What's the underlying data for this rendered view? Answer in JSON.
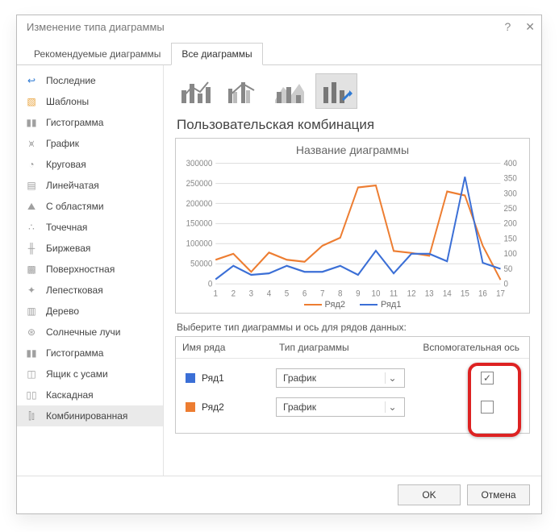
{
  "titlebar": {
    "title": "Изменение типа диаграммы"
  },
  "tabs": {
    "recommended": "Рекомендуемые диаграммы",
    "all": "Все диаграммы"
  },
  "sidebar": {
    "items": [
      "Последние",
      "Шаблоны",
      "Гистограмма",
      "График",
      "Круговая",
      "Линейчатая",
      "С областями",
      "Точечная",
      "Биржевая",
      "Поверхностная",
      "Лепестковая",
      "Дерево",
      "Солнечные лучи",
      "Гистограмма",
      "Ящик с усами",
      "Каскадная",
      "Комбинированная"
    ]
  },
  "section_title": "Пользовательская комбинация",
  "preview": {
    "title": "Название диаграммы"
  },
  "legend": {
    "s2": "Ряд2",
    "s1": "Ряд1"
  },
  "config_label": "Выберите тип диаграммы и ось для рядов данных:",
  "table": {
    "h_name": "Имя ряда",
    "h_type": "Тип диаграммы",
    "h_aux": "Вспомогательная ось",
    "rows": [
      {
        "name": "Ряд1",
        "color": "#3b6fd6",
        "type": "График",
        "aux": true
      },
      {
        "name": "Ряд2",
        "color": "#ed7d31",
        "type": "График",
        "aux": false
      }
    ]
  },
  "buttons": {
    "ok": "OK",
    "cancel": "Отмена"
  },
  "chart_data": {
    "type": "line",
    "categories": [
      1,
      2,
      3,
      4,
      5,
      6,
      7,
      8,
      9,
      10,
      11,
      12,
      13,
      14,
      15,
      16,
      17
    ],
    "title": "Название диаграммы",
    "xlabel": "",
    "ylabel": "",
    "y_left": {
      "min": 0,
      "max": 300000,
      "step": 50000
    },
    "y_right": {
      "min": 0,
      "max": 400,
      "step": 50
    },
    "series": [
      {
        "name": "Ряд2",
        "axis": "left",
        "color": "#ed7d31",
        "values": [
          60000,
          75000,
          30000,
          78000,
          60000,
          55000,
          95000,
          115000,
          240000,
          245000,
          82000,
          77000,
          70000,
          230000,
          220000,
          95000,
          10000
        ]
      },
      {
        "name": "Ряд1",
        "axis": "right",
        "color": "#3b6fd6",
        "values": [
          15,
          60,
          30,
          35,
          60,
          40,
          40,
          60,
          30,
          110,
          35,
          100,
          100,
          75,
          355,
          70,
          50
        ]
      }
    ]
  }
}
